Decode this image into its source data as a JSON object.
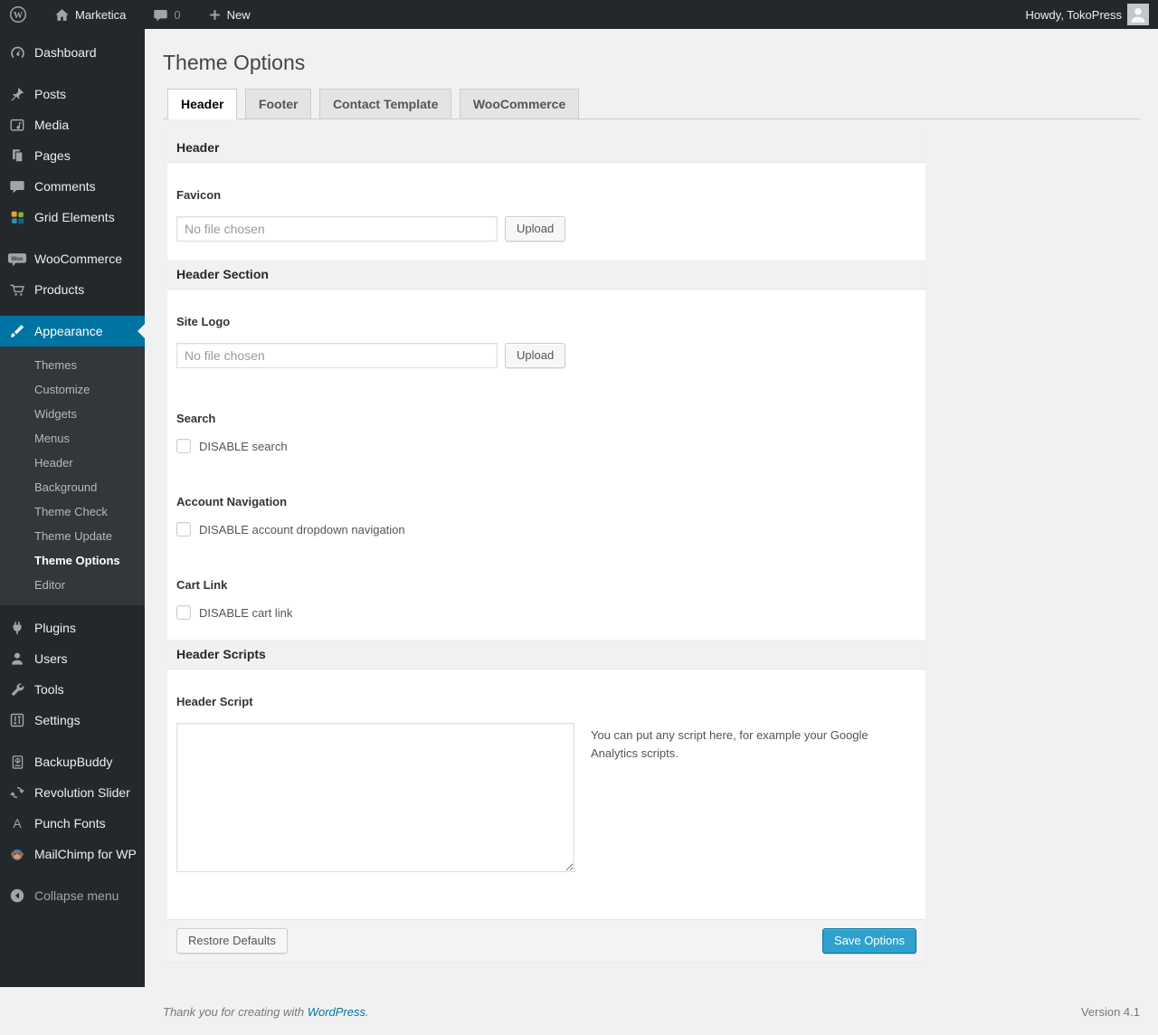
{
  "admin_bar": {
    "site_name": "Marketica",
    "comment_count": "0",
    "new_label": "New",
    "howdy_text": "Howdy, TokoPress"
  },
  "sidebar": {
    "group1": [
      {
        "label": "Dashboard"
      }
    ],
    "group2": [
      {
        "label": "Posts"
      },
      {
        "label": "Media"
      },
      {
        "label": "Pages"
      },
      {
        "label": "Comments"
      },
      {
        "label": "Grid Elements"
      }
    ],
    "group3": [
      {
        "label": "WooCommerce"
      },
      {
        "label": "Products"
      }
    ],
    "appearance": {
      "label": "Appearance",
      "submenu": [
        "Themes",
        "Customize",
        "Widgets",
        "Menus",
        "Header",
        "Background",
        "Theme Check",
        "Theme Update",
        "Theme Options",
        "Editor"
      ],
      "current_submenu": "Theme Options"
    },
    "group4": [
      {
        "label": "Plugins"
      },
      {
        "label": "Users"
      },
      {
        "label": "Tools"
      },
      {
        "label": "Settings"
      }
    ],
    "group5": [
      {
        "label": "BackupBuddy"
      },
      {
        "label": "Revolution Slider"
      },
      {
        "label": "Punch Fonts"
      },
      {
        "label": "MailChimp for WP"
      }
    ],
    "collapse_label": "Collapse menu"
  },
  "main": {
    "page_title": "Theme Options",
    "tabs": [
      {
        "label": "Header",
        "active": true
      },
      {
        "label": "Footer",
        "active": false
      },
      {
        "label": "Contact Template",
        "active": false
      },
      {
        "label": "WooCommerce",
        "active": false
      }
    ],
    "sections": {
      "header_bar": "Header",
      "favicon": {
        "label": "Favicon",
        "file_value": "No file chosen",
        "upload_label": "Upload"
      },
      "header_section_bar": "Header Section",
      "site_logo": {
        "label": "Site Logo",
        "file_value": "No file chosen",
        "upload_label": "Upload"
      },
      "search": {
        "label": "Search",
        "checkbox_label": "DISABLE search",
        "checked": false
      },
      "account_navigation": {
        "label": "Account Navigation",
        "checkbox_label": "DISABLE account dropdown navigation",
        "checked": false
      },
      "cart_link": {
        "label": "Cart Link",
        "checkbox_label": "DISABLE cart link",
        "checked": false
      },
      "header_scripts_bar": "Header Scripts",
      "header_script": {
        "label": "Header Script",
        "value": "",
        "help_text": "You can put any script here, for example your Google Analytics scripts."
      }
    },
    "footer_buttons": {
      "restore": "Restore Defaults",
      "save": "Save Options"
    }
  },
  "page_footer": {
    "thanks_prefix": "Thank you for creating with ",
    "wordpress_link": "WordPress",
    "thanks_suffix": ".",
    "version": "Version 4.1"
  },
  "colors": {
    "accent": "#0074a2",
    "primary_button": "#2ea2cc",
    "admin_bar_bg": "#23282d",
    "sidebar_bg": "#23282d",
    "submenu_bg": "#32373c",
    "page_bg": "#f1f1f1"
  }
}
